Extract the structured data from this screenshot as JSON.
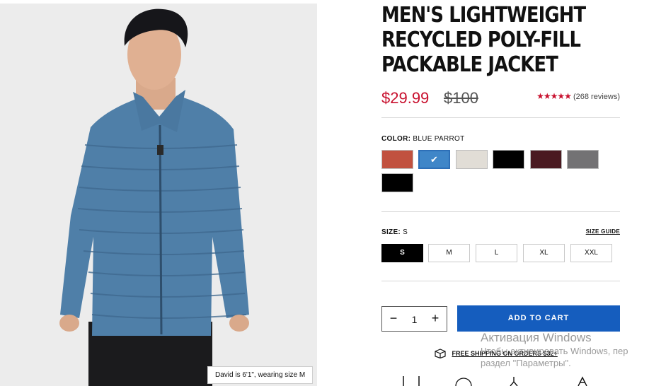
{
  "product": {
    "title_lines": [
      "MEN'S LIGHTWEIGHT",
      "RECYCLED POLY-FILL",
      "PACKABLE JACKET"
    ],
    "price_sale": "$29.99",
    "price_original": "$100",
    "stars": "★★★★★",
    "rating": 5,
    "reviews": "(268 reviews)",
    "model_caption": "David is 6'1\", wearing size M"
  },
  "color": {
    "label": "COLOR:",
    "selected_name": "BLUE PARROT",
    "swatches": [
      {
        "name": "rust",
        "hex": "#c1513f"
      },
      {
        "name": "blue-parrot",
        "hex": "#3f86c8",
        "selected": true
      },
      {
        "name": "cream",
        "hex": "#e1ddd6"
      },
      {
        "name": "black",
        "hex": "#000000"
      },
      {
        "name": "burgundy",
        "hex": "#4a1a21"
      },
      {
        "name": "gray",
        "hex": "#737274"
      },
      {
        "name": "black-2",
        "hex": "#000000"
      }
    ]
  },
  "size": {
    "label": "SIZE:",
    "selected": "S",
    "guide_label": "SIZE GUIDE",
    "options": [
      "S",
      "M",
      "L",
      "XL",
      "XXL"
    ]
  },
  "cart": {
    "minus": "−",
    "quantity": "1",
    "plus": "+",
    "add_label": "ADD TO CART"
  },
  "shipping": {
    "text": "FREE SHIPPING ON ORDERS $32+"
  },
  "os_watermark": {
    "title": "Активация Windows",
    "line1": "Чтобы активировать Windows, пер",
    "line2": "раздел \"Параметры\"."
  },
  "colors": {
    "accent_red": "#c8102e",
    "button_blue": "#155dbe",
    "jacket_blue": "#4f7fa8"
  }
}
